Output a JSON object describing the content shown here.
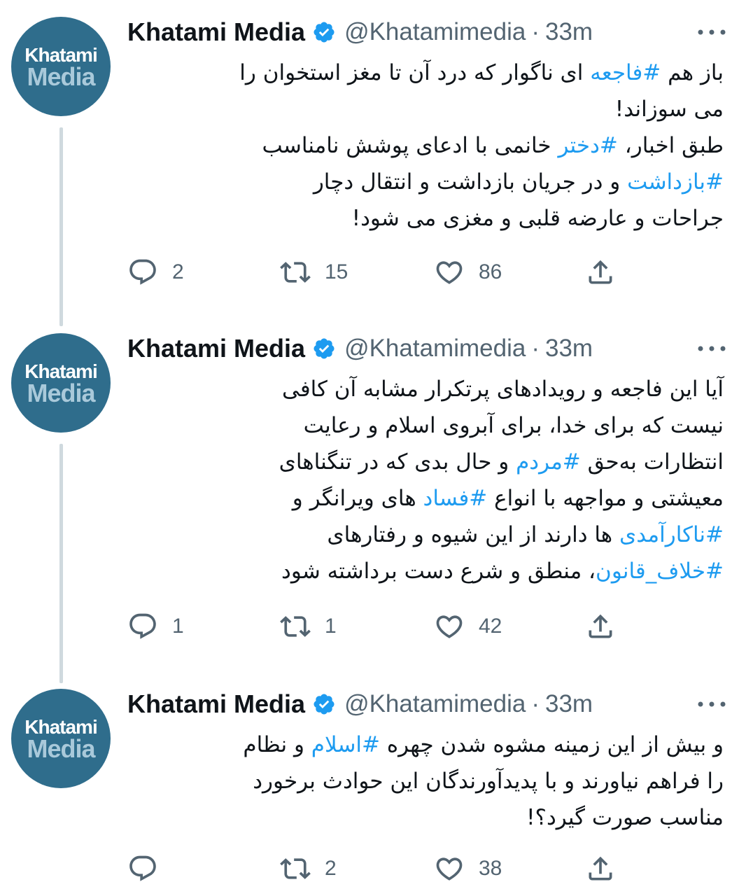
{
  "author": {
    "name": "Khatami Media",
    "handle": "@Khatamimedia",
    "separator": "·",
    "avatar_line1": "Khatami",
    "avatar_line2": "Media"
  },
  "icons": {
    "verified": "verified-badge-icon",
    "more": "more-options-icon",
    "reply": "reply-icon",
    "retweet": "retweet-icon",
    "like": "heart-icon",
    "share": "share-icon"
  },
  "colors": {
    "hashtag": "#1d9bf0",
    "secondary_text": "#536471",
    "avatar_bg": "#2f6d8c",
    "thread_line": "#cfd9de"
  },
  "tweets": [
    {
      "time": "33m",
      "lines": [
        [
          {
            "t": "باز هم "
          },
          {
            "t": "#فاجعه",
            "h": true
          },
          {
            "t": " ای ناگوار که درد آن تا مغز استخوان را"
          }
        ],
        [
          {
            "t": "می سوزاند!"
          }
        ],
        [
          {
            "t": "طبق اخبار، "
          },
          {
            "t": "#دختر",
            "h": true
          },
          {
            "t": " خانمی با ادعای پوشش نامناسب"
          }
        ],
        [
          {
            "t": "#بازداشت",
            "h": true
          },
          {
            "t": " و در جریان بازداشت و انتقال دچار"
          }
        ],
        [
          {
            "t": "جراحات و عارضه قلبی و مغزی می شود!"
          }
        ]
      ],
      "replies": "2",
      "retweets": "15",
      "likes": "86"
    },
    {
      "time": "33m",
      "lines": [
        [
          {
            "t": "آیا این فاجعه و رویدادهای پرتکرار مشابه آن کافی"
          }
        ],
        [
          {
            "t": "نیست که برای خدا، برای آبروی اسلام و رعایت"
          }
        ],
        [
          {
            "t": "انتظارات به‌حق "
          },
          {
            "t": "#مردم",
            "h": true
          },
          {
            "t": " و حال بدی که در تنگناهای"
          }
        ],
        [
          {
            "t": "معیشتی و مواجهه با انواع "
          },
          {
            "t": "#فساد",
            "h": true
          },
          {
            "t": " های ویرانگر و"
          }
        ],
        [
          {
            "t": "#ناکارآمدی",
            "h": true
          },
          {
            "t": " ها دارند از این شیوه و رفتارهای"
          }
        ],
        [
          {
            "t": "#خلاف_قانون",
            "h": true
          },
          {
            "t": "، منطق و شرع دست برداشته شود"
          }
        ]
      ],
      "replies": "1",
      "retweets": "1",
      "likes": "42"
    },
    {
      "time": "33m",
      "lines": [
        [
          {
            "t": "و بیش از این زمینه مشوه شدن چهره "
          },
          {
            "t": "#اسلام",
            "h": true
          },
          {
            "t": " و نظام"
          }
        ],
        [
          {
            "t": "را فراهم نیاورند و با پدیدآورندگان این حوادث برخورد"
          }
        ],
        [
          {
            "t": "مناسب صورت گیرد؟!"
          }
        ]
      ],
      "replies": "",
      "retweets": "2",
      "likes": "38"
    }
  ]
}
